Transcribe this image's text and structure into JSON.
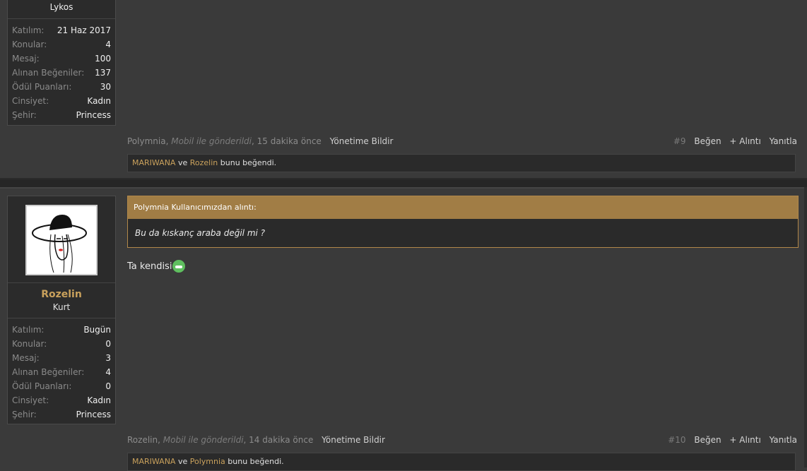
{
  "post1": {
    "user": {
      "name": "Lykos",
      "stats": [
        {
          "label": "Katılım:",
          "value": "21 Haz 2017"
        },
        {
          "label": "Konular:",
          "value": "4"
        },
        {
          "label": "Mesaj:",
          "value": "100"
        },
        {
          "label": "Alınan Beğeniler:",
          "value": "137"
        },
        {
          "label": "Ödül Puanları:",
          "value": "30"
        },
        {
          "label": "Cinsiyet:",
          "value": "Kadın"
        },
        {
          "label": "Şehir:",
          "value": "Princess"
        }
      ]
    },
    "footer": {
      "author": "Polymnia",
      "mobile": "Mobil ile gönderildi",
      "time": "15 dakika önce",
      "report": "Yönetime Bildir",
      "number": "#9",
      "like": "Beğen",
      "quote": "+ Alıntı",
      "reply": "Yanıtla"
    },
    "likes": {
      "user1": "MARIWANA",
      "and": "ve",
      "user2": "Rozelin",
      "suffix": "bunu beğendi."
    }
  },
  "post2": {
    "user": {
      "name": "Rozelin",
      "title": "Kurt",
      "stats": [
        {
          "label": "Katılım:",
          "value": "Bugün"
        },
        {
          "label": "Konular:",
          "value": "0"
        },
        {
          "label": "Mesaj:",
          "value": "3"
        },
        {
          "label": "Alınan Beğeniler:",
          "value": "4"
        },
        {
          "label": "Ödül Puanları:",
          "value": "0"
        },
        {
          "label": "Cinsiyet:",
          "value": "Kadın"
        },
        {
          "label": "Şehir:",
          "value": "Princess"
        }
      ]
    },
    "quote": {
      "header": "Polymnia Kullanıcımızdan alıntı:",
      "text": "Bu da kıskanç araba değil mi ?"
    },
    "body": "Ta kendisi",
    "emoji_icon": "grin-emoji-icon",
    "footer": {
      "author": "Rozelin",
      "mobile": "Mobil ile gönderildi",
      "time": "14 dakika önce",
      "report": "Yönetime Bildir",
      "number": "#10",
      "like": "Beğen",
      "quote": "+ Alıntı",
      "reply": "Yanıtla"
    },
    "likes": {
      "user1": "MARIWANA",
      "and": "ve",
      "user2": "Polymnia",
      "suffix": "bunu beğendi."
    }
  },
  "colors": {
    "accent": "#c9a15c",
    "quote_header": "#a17d45",
    "background": "#3a3a3a"
  }
}
